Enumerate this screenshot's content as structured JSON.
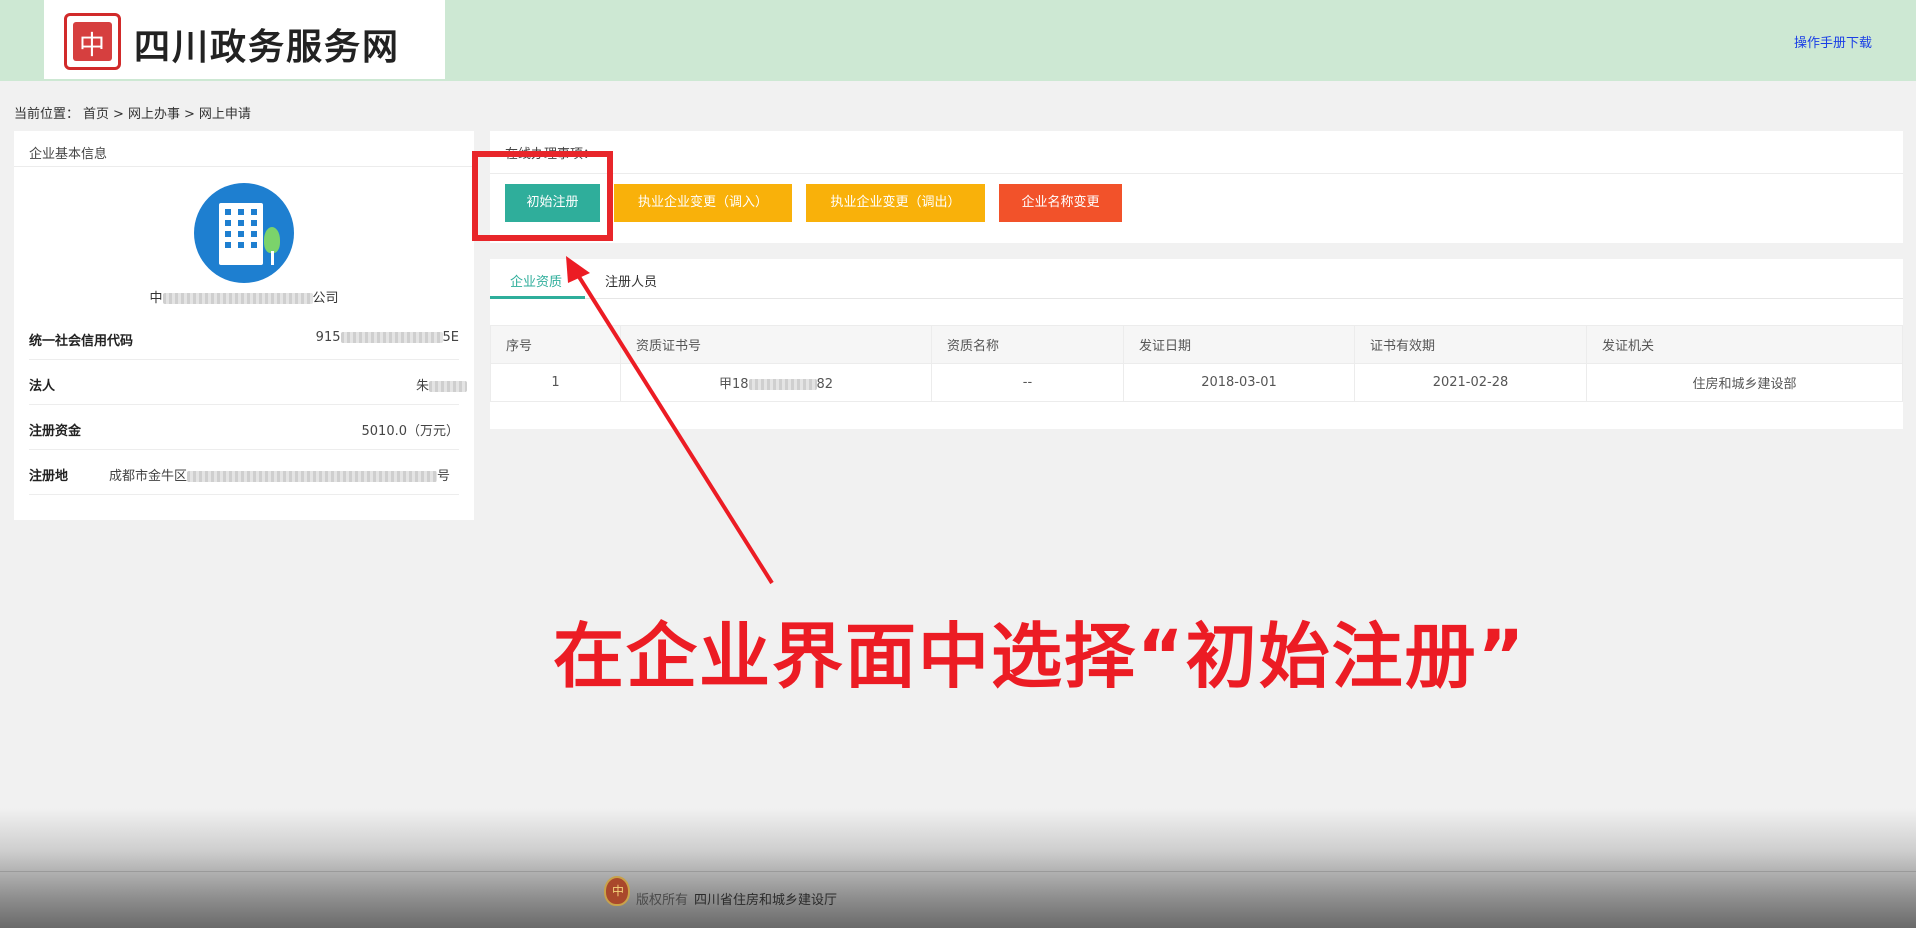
{
  "header": {
    "site_title": "四川政务服务网",
    "logo_glyph": "中",
    "manual_link": "操作手册下载"
  },
  "breadcrumb": {
    "prefix": "当前位置：",
    "items": [
      "首页",
      "网上办事",
      "网上申请"
    ],
    "separator": ">"
  },
  "company": {
    "panel_title": "企业基本信息",
    "name_start": "中",
    "name_end": "公司",
    "fields": [
      {
        "label": "统一社会信用代码",
        "value_start": "915",
        "value_end": "5E"
      },
      {
        "label": "法人",
        "value_start": "朱",
        "value_end": ""
      },
      {
        "label": "注册资金",
        "value": "5010.0（万元）"
      },
      {
        "label": "注册地",
        "value_start": "成都市金牛区",
        "value_end": "号"
      }
    ]
  },
  "operations": {
    "title": "在线办理事项：",
    "buttons": [
      "初始注册",
      "执业企业变更（调入）",
      "执业企业变更（调出）",
      "企业名称变更"
    ],
    "colors": {
      "green": "#2fae9b",
      "amber": "#f9b10a",
      "red": "#f2522a"
    }
  },
  "tabs": {
    "items": [
      "企业资质",
      "注册人员"
    ],
    "active": "企业资质"
  },
  "table": {
    "headers": [
      "序号",
      "资质证书号",
      "资质名称",
      "发证日期",
      "证书有效期",
      "发证机关"
    ],
    "rows": [
      {
        "index": "1",
        "cert_start": "甲18",
        "cert_end": "82",
        "name": "--",
        "issue_date": "2018-03-01",
        "valid_until": "2021-02-28",
        "authority": "住房和城乡建设部"
      }
    ]
  },
  "annotation": {
    "text": "在企业界面中选择“初始注册”",
    "color": "#ec1c24"
  },
  "footer": {
    "copyright": "版权所有",
    "org": "四川省住房和城乡建设厅",
    "emblem_glyph": "中"
  }
}
